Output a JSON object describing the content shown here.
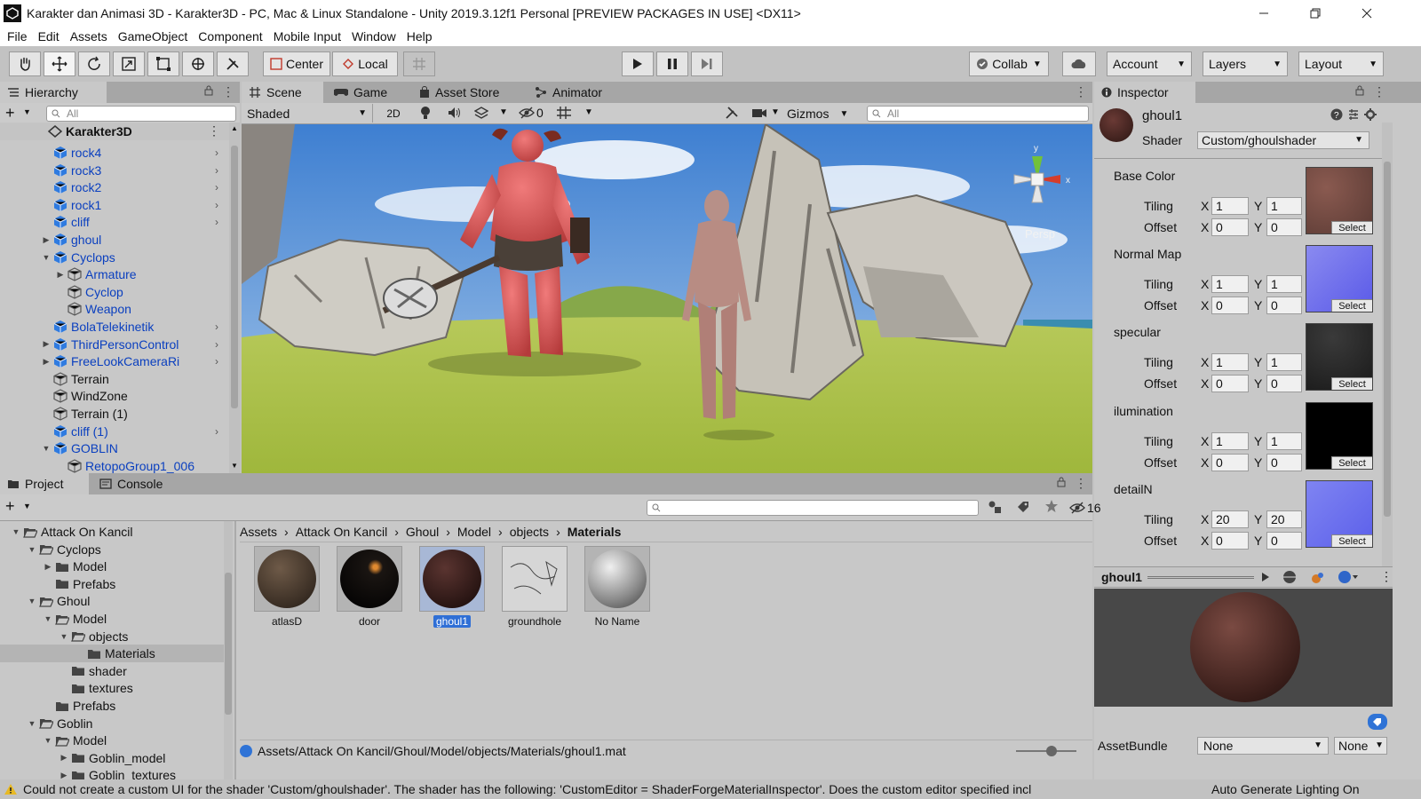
{
  "window": {
    "title": "Karakter dan Animasi 3D - Karakter3D - PC, Mac & Linux Standalone - Unity 2019.3.12f1 Personal [PREVIEW PACKAGES IN USE] <DX11>"
  },
  "menu": [
    "File",
    "Edit",
    "Assets",
    "GameObject",
    "Component",
    "Mobile Input",
    "Window",
    "Help"
  ],
  "toolbar": {
    "pivot_label": "Center",
    "space_label": "Local",
    "collab_label": "Collab",
    "account_label": "Account",
    "layers_label": "Layers",
    "layout_label": "Layout"
  },
  "hierarchy": {
    "tab": "Hierarchy",
    "search_placeholder": "All",
    "scene_name": "Karakter3D",
    "items": [
      {
        "label": "rock4"
      },
      {
        "label": "rock3"
      },
      {
        "label": "rock2"
      },
      {
        "label": "rock1"
      },
      {
        "label": "cliff"
      },
      {
        "label": "ghoul"
      },
      {
        "label": "Cyclops"
      },
      {
        "label": "Armature"
      },
      {
        "label": "Cyclop"
      },
      {
        "label": "Weapon"
      },
      {
        "label": "BolaTelekinetik"
      },
      {
        "label": "ThirdPersonControl"
      },
      {
        "label": "FreeLookCameraRi"
      },
      {
        "label": "Terrain"
      },
      {
        "label": "WindZone"
      },
      {
        "label": "Terrain (1)"
      },
      {
        "label": "cliff (1)"
      },
      {
        "label": "GOBLIN"
      },
      {
        "label": "RetopoGroup1_006"
      }
    ]
  },
  "scene": {
    "tabs": [
      "Scene",
      "Game",
      "Asset Store",
      "Animator"
    ],
    "shading_mode": "Shaded",
    "mode_2d": "2D",
    "hidden_count": "0",
    "gizmos_label": "Gizmos",
    "search_placeholder": "All",
    "persp_label": "Persp"
  },
  "inspector": {
    "tab": "Inspector",
    "material_name": "ghoul1",
    "shader_label": "Shader",
    "shader_value": "Custom/ghoulshader",
    "tiling_label": "Tiling",
    "offset_label": "Offset",
    "x_label": "X",
    "y_label": "Y",
    "select_label": "Select",
    "textures": [
      {
        "name": "Base Color",
        "tiling_x": "1",
        "tiling_y": "1",
        "offset_x": "0",
        "offset_y": "0"
      },
      {
        "name": "Normal Map",
        "tiling_x": "1",
        "tiling_y": "1",
        "offset_x": "0",
        "offset_y": "0"
      },
      {
        "name": "specular",
        "tiling_x": "1",
        "tiling_y": "1",
        "offset_x": "0",
        "offset_y": "0"
      },
      {
        "name": "ilumination",
        "tiling_x": "1",
        "tiling_y": "1",
        "offset_x": "0",
        "offset_y": "0"
      },
      {
        "name": "detailN",
        "tiling_x": "20",
        "tiling_y": "20",
        "offset_x": "0",
        "offset_y": "0"
      }
    ],
    "preview_name": "ghoul1",
    "assetbundle_label": "AssetBundle",
    "assetbundle_value": "None",
    "assetbundle_variant": "None"
  },
  "project": {
    "tabs": [
      "Project",
      "Console"
    ],
    "hidden_count": "16",
    "tree": [
      {
        "label": "Attack On Kancil"
      },
      {
        "label": "Cyclops"
      },
      {
        "label": "Model"
      },
      {
        "label": "Prefabs"
      },
      {
        "label": "Ghoul"
      },
      {
        "label": "Model"
      },
      {
        "label": "objects"
      },
      {
        "label": "Materials"
      },
      {
        "label": "shader"
      },
      {
        "label": "textures"
      },
      {
        "label": "Prefabs"
      },
      {
        "label": "Goblin"
      },
      {
        "label": "Model"
      },
      {
        "label": "Goblin_model"
      },
      {
        "label": "Goblin_textures"
      }
    ],
    "breadcrumb": [
      "Assets",
      "Attack On Kancil",
      "Ghoul",
      "Model",
      "objects",
      "Materials"
    ],
    "assets": [
      {
        "name": "atlasD"
      },
      {
        "name": "door"
      },
      {
        "name": "ghoul1"
      },
      {
        "name": "groundhole"
      },
      {
        "name": "No Name"
      }
    ],
    "path": "Assets/Attack On Kancil/Ghoul/Model/objects/Materials/ghoul1.mat"
  },
  "status": {
    "message": "Could not create a custom UI for the shader 'Custom/ghoulshader'. The shader has the following: 'CustomEditor = ShaderForgeMaterialInspector'. Does the custom editor specified incl",
    "right": "Auto Generate Lighting On"
  }
}
